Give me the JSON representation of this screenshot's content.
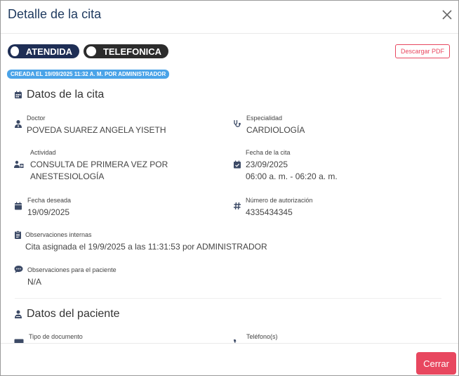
{
  "modal": {
    "title": "Detalle de la cita"
  },
  "status": {
    "toggles": [
      {
        "label": "ATENDIDA"
      },
      {
        "label": "TELEFONICA"
      }
    ],
    "pdf_label": "Descargar PDF",
    "created_badge": "CREADA EL 19/09/2025 11:32 A. M. POR ADMINISTRADOR"
  },
  "cita": {
    "section_title": "Datos de la cita",
    "doctor_label": "Doctor",
    "doctor_value": "POVEDA SUAREZ ANGELA YISETH",
    "especialidad_label": "Especialidad",
    "especialidad_value": "CARDIOLOGÍA",
    "actividad_label": "Actividad",
    "actividad_line1": "CONSULTA DE PRIMERA VEZ POR",
    "actividad_line2": "ANESTESIOLOGÍA",
    "fecha_label": "Fecha de la cita",
    "fecha_value": "23/09/2025",
    "hora_value": "06:00 a. m. - 06:20 a. m.",
    "fecha_deseada_label": "Fecha deseada",
    "fecha_deseada_value": "19/09/2025",
    "autorizacion_label": "Número de autorización",
    "autorizacion_value": "4335434345",
    "obs_internas_label": "Observaciones internas",
    "obs_internas_value": "Cita asignada el 19/9/2025 a las 11:31:53 por ADMINISTRADOR",
    "obs_paciente_label": "Observaciones para el paciente",
    "obs_paciente_value": "N/A"
  },
  "paciente": {
    "section_title": "Datos del paciente",
    "tipo_doc_label": "Tipo de documento",
    "telefono_label": "Teléfono(s)"
  },
  "footer": {
    "close_label": "Cerrar"
  },
  "colors": {
    "title": "#1f3a5f",
    "pill_blue": "#1e2e55",
    "pill_dark": "#2c2c2c",
    "accent": "#e8475f",
    "badge": "#4aa3e8",
    "icon": "#3c4a66"
  }
}
